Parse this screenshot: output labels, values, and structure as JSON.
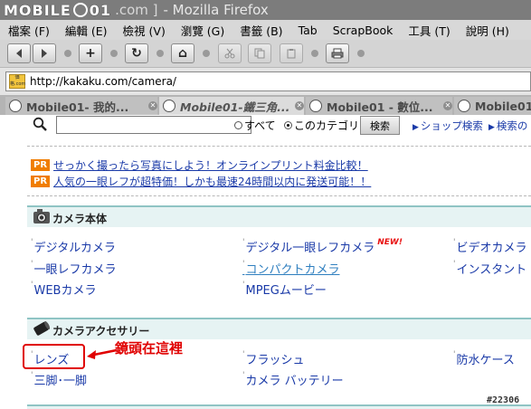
{
  "titlebar": {
    "brand_left": "MOBILE",
    "brand_right": "01",
    "url_fragment": ".com ]",
    "app_title": "- Mozilla Firefox"
  },
  "menubar": {
    "items": [
      "檔案 (F)",
      "編輯 (E)",
      "檢視 (V)",
      "瀏覽 (G)",
      "書籤 (B)",
      "Tab",
      "ScrapBook",
      "工具 (T)",
      "說明 (H)"
    ]
  },
  "toolbar": {
    "back_icon": "back-arrow-icon",
    "forward_icon": "forward-arrow-icon",
    "new_tab_glyph": "+",
    "reload_glyph": "↻",
    "home_glyph": "⌂"
  },
  "addressbar": {
    "favicon_text": "価格.com",
    "url": "http://kakaku.com/camera/"
  },
  "tabs": [
    {
      "label": "Mobile01- 我的..."
    },
    {
      "label": "Mobile01-鐵三角..."
    },
    {
      "label": "Mobile01 - 數位..."
    },
    {
      "label": "Mobile01"
    }
  ],
  "search": {
    "input_value": "",
    "radio_all": "すべて",
    "radio_category": "このカテゴリ",
    "button": "検索",
    "shop_search": "ショップ検索",
    "search_other": "検索の"
  },
  "pr_links": [
    {
      "badge": "PR",
      "text": "せっかく撮ったら写真にしよう！オンラインプリント料金比較！"
    },
    {
      "badge": "PR",
      "text": "人気の一眼レフが超特価！しかも最速24時間以内に発送可能！！"
    }
  ],
  "sections": {
    "camera_body": {
      "title": "カメラ本体",
      "items": [
        "デジタルカメラ",
        "デジタル一眼レフカメラ",
        "ビデオカメラ",
        "一眼レフカメラ",
        "コンパクトカメラ",
        "インスタント",
        "WEBカメラ",
        "MPEGムービー"
      ],
      "new_badge": "NEW!"
    },
    "accessories": {
      "title": "カメラアクセサリー",
      "items": [
        "レンズ",
        "フラッシュ",
        "防水ケース",
        "三脚･一脚",
        "カメラ バッテリー"
      ]
    }
  },
  "annotation": {
    "text": "鏡頭在這裡"
  },
  "watermark": "#22306",
  "colors": {
    "link": "#1a3aa8",
    "visited": "#2f7fbf",
    "pr_badge": "#f07d00",
    "annotation": "#e00000",
    "section_bg": "#e6f3f3"
  }
}
